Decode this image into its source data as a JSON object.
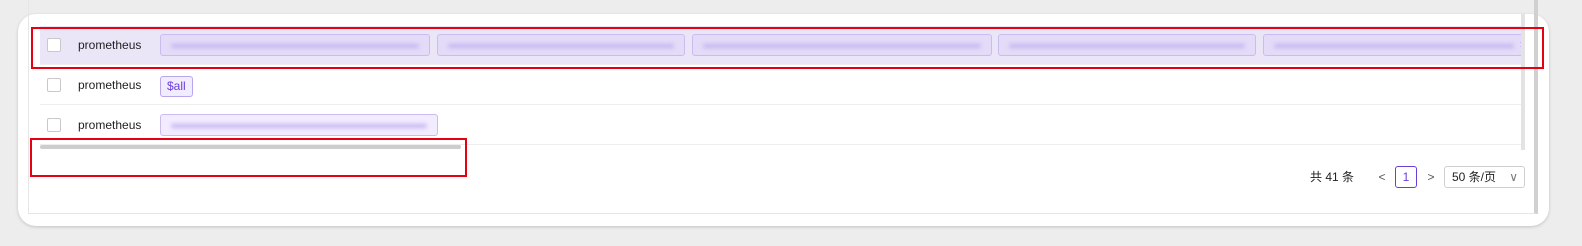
{
  "table": {
    "rows": [
      {
        "name": "prometheus",
        "selected": true,
        "tags": [
          "",
          "",
          "",
          "",
          ""
        ],
        "overflow_glyph": "›"
      },
      {
        "name": "prometheus",
        "selected": false,
        "tags": [
          "$all"
        ]
      },
      {
        "name": "prometheus",
        "selected": false,
        "tags": [
          ""
        ]
      }
    ]
  },
  "pagination": {
    "total": "共 41 条",
    "prev": "<",
    "current": "1",
    "next": ">",
    "page_size": "50 条/页",
    "chevron_icon": "chevron-down-icon"
  },
  "colors": {
    "selected_row": "#ebe5f8",
    "tag_border": "#b9a7ec",
    "accent": "#6b3fd6",
    "highlight": "#e60012"
  }
}
